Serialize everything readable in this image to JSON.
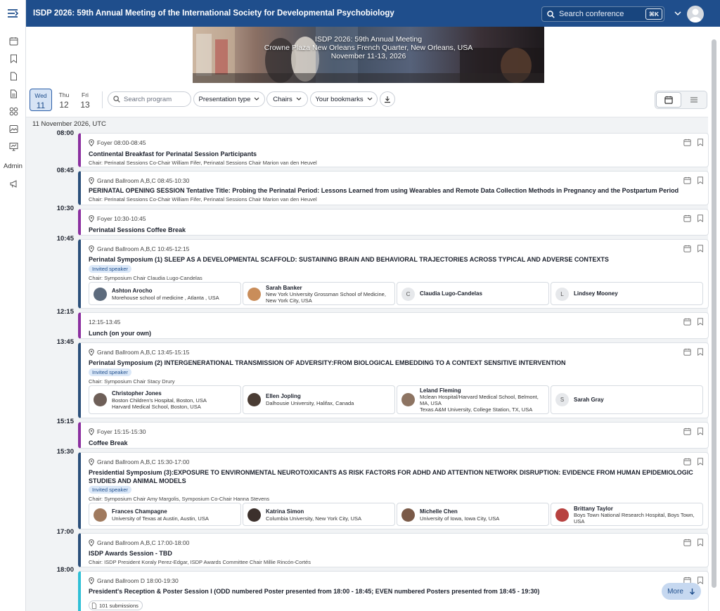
{
  "app": {
    "title": "ISDP 2026: 59th Annual Meeting of the International Society for Developmental Psychobiology",
    "search_placeholder": "Search conference",
    "search_shortcut": "⌘K",
    "admin_label": "Admin"
  },
  "banner": {
    "line1": "ISDP 2026: 59th Annual Meeting",
    "line2": "Crowne Plaza New Orleans French Quarter, New Orleans, USA",
    "line3": "November 11-13, 2026"
  },
  "days": [
    {
      "name": "Wed",
      "num": "11"
    },
    {
      "name": "Thu",
      "num": "12"
    },
    {
      "name": "Fri",
      "num": "13"
    }
  ],
  "filters": {
    "search_placeholder": "Search program",
    "presentation_type": "Presentation type",
    "chairs": "Chairs",
    "bookmarks": "Your bookmarks"
  },
  "day_header": "11 November 2026, UTC",
  "times": [
    "08:00",
    "08:45",
    "10:30",
    "10:45",
    "12:15",
    "13:45",
    "15:15",
    "15:30",
    "17:00",
    "18:00"
  ],
  "sessions": [
    {
      "loc": "Foyer 08:00-08:45",
      "title": "Continental Breakfast for Perinatal Session Participants",
      "chair": "Chair: Perinatal Sessions Co-Chair William Fifer, Perinatal Sessions Chair Marion van den Heuvel"
    },
    {
      "loc": "Grand Ballroom A,B,C 08:45-10:30",
      "title": "PERINATAL OPENING SESSION Tentative Title: Probing the Perinatal Period: Lessons Learned from using Wearables and Remote Data Collection Methods in Pregnancy and the Postpartum Period",
      "chair": "Chair: Perinatal Sessions Co-Chair William Fifer, Perinatal Sessions Chair Marion van den Heuvel"
    },
    {
      "loc": "Foyer 10:30-10:45",
      "title": "Perinatal Sessions Coffee Break"
    },
    {
      "loc": "Grand Ballroom A,B,C 10:45-12:15",
      "title": "Perinatal Symposium (1) SLEEP AS A DEVELOPMENTAL SCAFFOLD: SUSTAINING BRAIN AND BEHAVIORAL TRAJECTORIES ACROSS TYPICAL AND ADVERSE CONTEXTS",
      "badge": "Invited speaker",
      "chair": "Chair: Symposium Chair Claudia Lugo-Candelas",
      "people": [
        {
          "name": "Ashton Arocho",
          "aff": "Morehouse school of medicine , Atlanta , USA"
        },
        {
          "name": "Sarah Banker",
          "aff": "New York University Grossman School of Medicine, New York City, USA"
        },
        {
          "name": "Claudia Lugo-Candelas",
          "aff": "",
          "initial": "C"
        },
        {
          "name": "Lindsey Mooney",
          "aff": "",
          "initial": "L"
        }
      ]
    },
    {
      "loc": "12:15-13:45",
      "title": "Lunch (on your own)"
    },
    {
      "loc": "Grand Ballroom A,B,C 13:45-15:15",
      "title": "Perinatal Symposium (2) INTERGENERATIONAL TRANSMISSION OF ADVERSITY:FROM BIOLOGICAL EMBEDDING TO A CONTEXT SENSITIVE INTERVENTION",
      "badge": "Invited speaker",
      "chair": "Chair: Symposium Chair Stacy Drury",
      "people": [
        {
          "name": "Christopher Jones",
          "aff": "Boston Children's Hospital, Boston, USA",
          "aff2": "Harvard Medical School, Boston, USA"
        },
        {
          "name": "Ellen Jopling",
          "aff": "Dalhousie University, Halifax, Canada"
        },
        {
          "name": "Leland Fleming",
          "aff": "Mclean Hospital/Harvard Medical School, Belmont, MA, USA",
          "aff2": "Texas A&M University, College Station, TX, USA"
        },
        {
          "name": "Sarah Gray",
          "aff": "",
          "initial": "S"
        }
      ]
    },
    {
      "loc": "Foyer 15:15-15:30",
      "title": "Coffee Break"
    },
    {
      "loc": "Grand Ballroom A,B,C 15:30-17:00",
      "title": "Presidential Symposium (3):EXPOSURE TO ENVIRONMENTAL NEUROTOXICANTS AS RISK FACTORS FOR ADHD AND ATTENTION NETWORK DISRUPTION: EVIDENCE FROM HUMAN EPIDEMIOLOGIC STUDIES AND ANIMAL MODELS",
      "badge": "Invited speaker",
      "chair": "Chair: Symposium Chair Amy Margolis, Symposium Co-Chair Hanna Stevens",
      "people": [
        {
          "name": "Frances Champagne",
          "aff": "University of Texas at Austin, Austin, USA"
        },
        {
          "name": "Katrina Simon",
          "aff": "Columbia University, New York City, USA"
        },
        {
          "name": "Michelle Chen",
          "aff": "University of Iowa, Iowa City, USA"
        },
        {
          "name": "Brittany Taylor",
          "aff": "Boys Town National Research Hospital, Boys Town, USA"
        }
      ]
    },
    {
      "loc": "Grand Ballroom A,B,C 17:00-18:00",
      "title": "ISDP Awards Session - TBD",
      "chair": "Chair: ISDP President Koraly Perez-Edgar, ISDP Awards Committee Chair Millie Rincón-Cortés"
    },
    {
      "loc": "Grand Ballroom D 18:00-19:30",
      "title": "President's Reception & Poster Session I (ODD numbered Poster presented from 18:00 - 18:45; EVEN numbered Posters presented from 18:45 - 19:30)",
      "submissions": "101 submissions"
    }
  ],
  "more_label": "More",
  "colors": {
    "topbar": "#1f4e8c",
    "accent_purple": "#8b2fa0",
    "accent_navy": "#2b4f7a",
    "accent_cyan": "#2fbfd6"
  }
}
